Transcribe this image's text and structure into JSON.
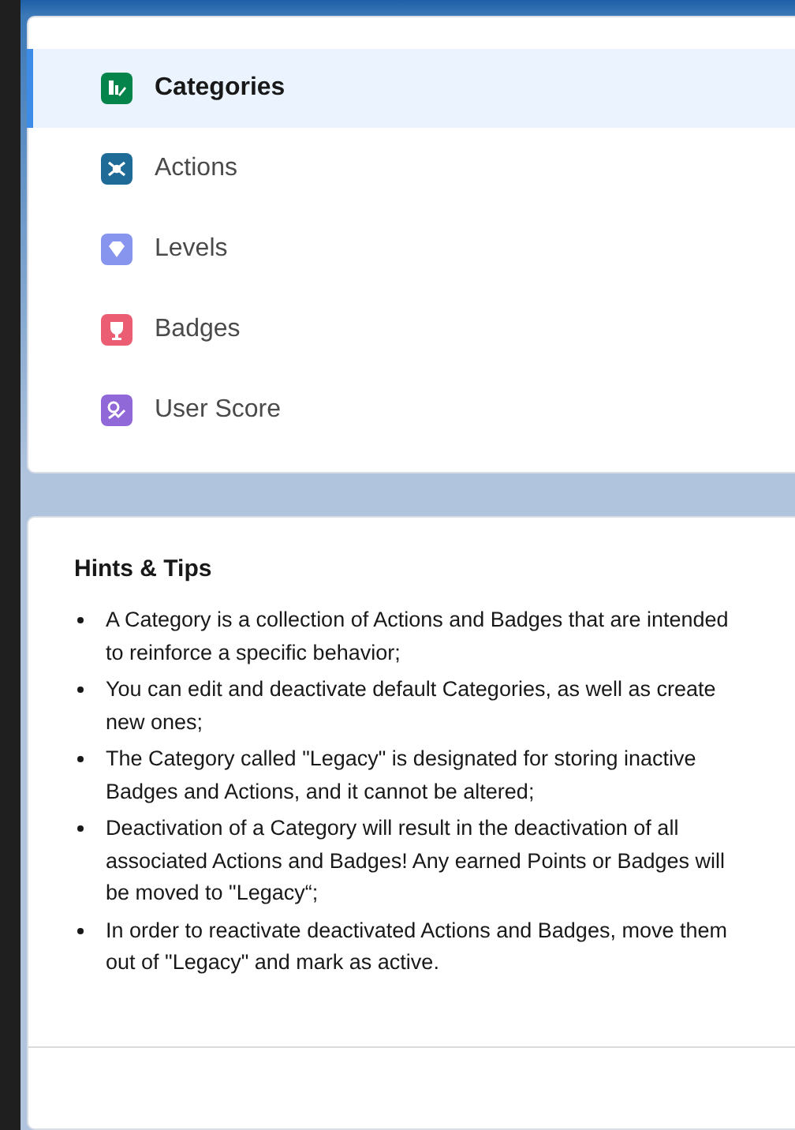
{
  "nav": {
    "items": [
      {
        "label": "Categories",
        "selected": true,
        "color": "#04844b"
      },
      {
        "label": "Actions",
        "selected": false,
        "color": "#1e6b97"
      },
      {
        "label": "Levels",
        "selected": false,
        "color": "#8795ef"
      },
      {
        "label": "Badges",
        "selected": false,
        "color": "#ea5d72"
      },
      {
        "label": "User Score",
        "selected": false,
        "color": "#9068d8"
      }
    ]
  },
  "hints": {
    "title": "Hints & Tips",
    "items": [
      "A Category is a collection of Actions and Badges that are intended to reinforce a specific behavior;",
      "You can edit and deactivate default Categories, as well as create new ones;",
      "The Category called \"Legacy\" is designated for storing inactive Badges and Actions, and it cannot be altered;",
      "Deactivation of a Category will result in the deactivation of all associated Actions and Badges! Any earned Points or Badges will be moved to \"Legacy“;",
      "In order to reactivate deactivated Actions and Badges, move them out of \"Legacy\" and mark as active."
    ]
  }
}
